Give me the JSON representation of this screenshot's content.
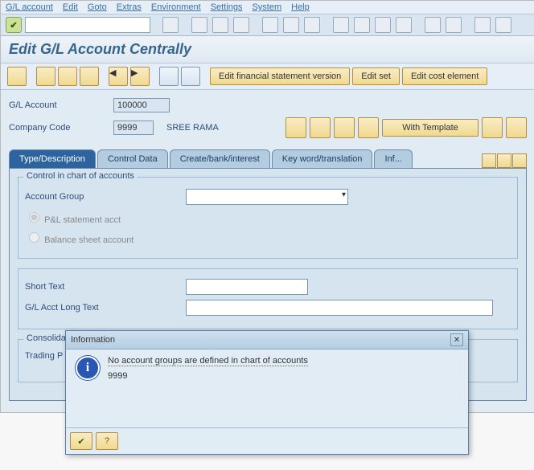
{
  "menu": [
    "G/L account",
    "Edit",
    "Goto",
    "Extras",
    "Environment",
    "Settings",
    "System",
    "Help"
  ],
  "page_title": "Edit G/L Account Centrally",
  "appbar": {
    "buttons": [
      "Edit financial statement version",
      "Edit set",
      "Edit cost element"
    ]
  },
  "header": {
    "gl_label": "G/L Account",
    "gl_value": "100000",
    "cc_label": "Company Code",
    "cc_value": "9999",
    "cc_name": "SREE RAMA",
    "with_template": "With Template"
  },
  "tabs": [
    "Type/Description",
    "Control Data",
    "Create/bank/interest",
    "Key word/translation",
    "Inf..."
  ],
  "panel": {
    "group1_title": "Control in chart of accounts",
    "acct_group_label": "Account Group",
    "pl_label": "P&L statement acct",
    "bs_label": "Balance sheet account",
    "short_text_label": "Short Text",
    "long_text_label": "G/L Acct Long Text",
    "consolidation_label": "Consolida",
    "trading_label": "Trading P"
  },
  "dialog": {
    "title": "Information",
    "message": "No account groups are defined in chart of accounts",
    "detail": "9999"
  }
}
